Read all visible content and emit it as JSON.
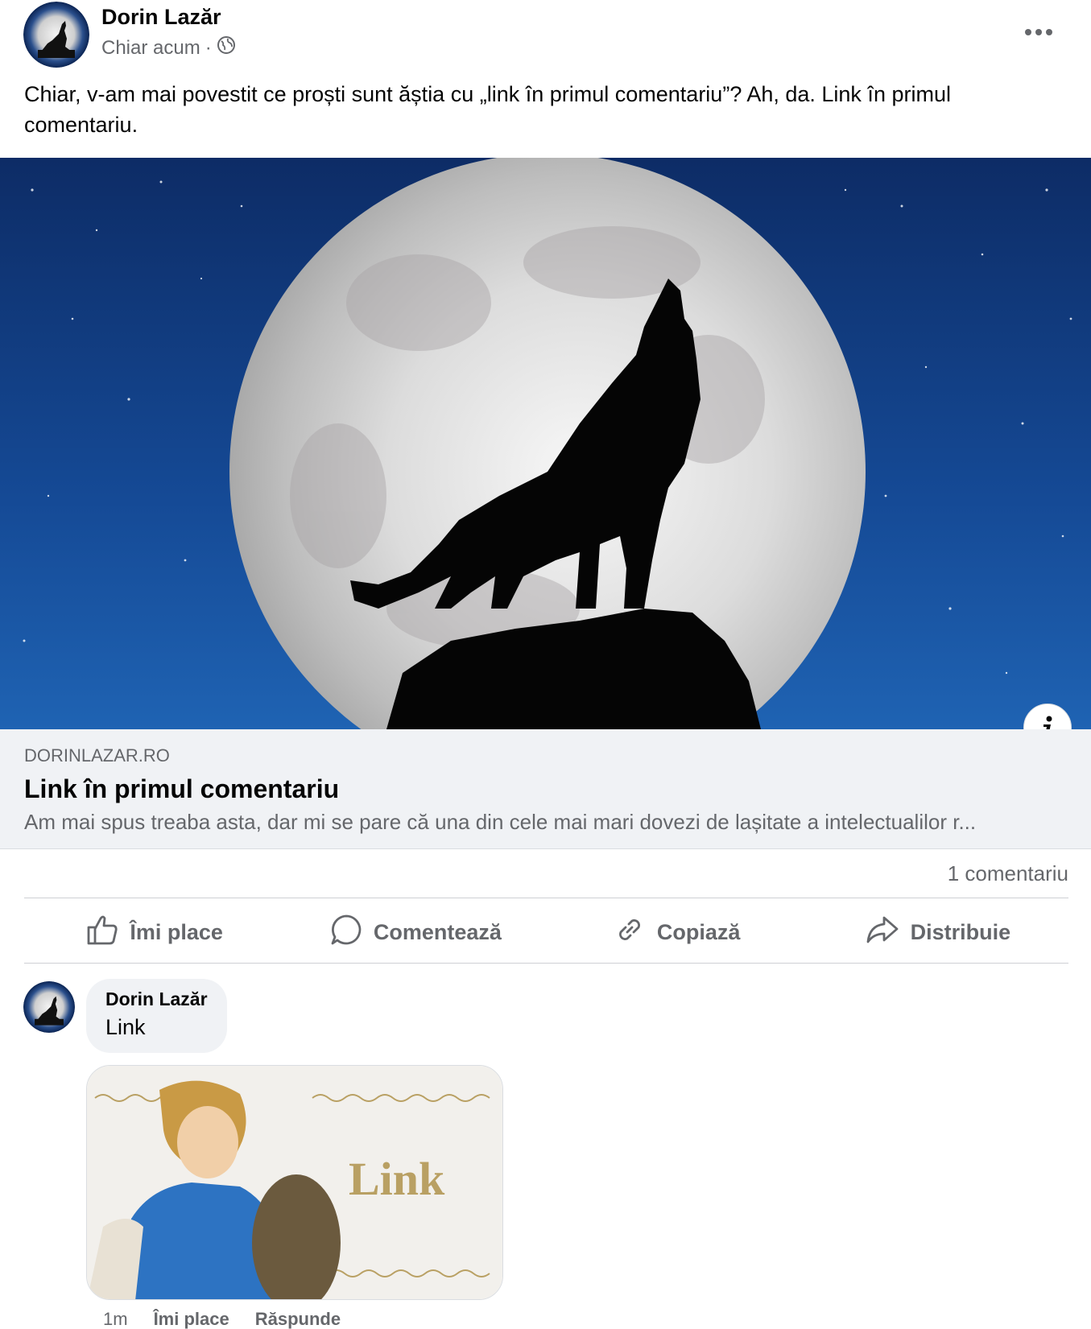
{
  "post": {
    "author": "Dorin Lazăr",
    "time": "Chiar acum",
    "separator": "·",
    "audience_icon": "globe-icon",
    "more_icon": "more-options-icon",
    "text": "Chiar, v-am mai povestit ce proști sunt ăștia cu „link în primul comentariu”? Ah, da. Link în primul comentariu."
  },
  "link_preview": {
    "domain": "DORINLAZAR.RO",
    "title": "Link în primul comentariu",
    "description": "Am mai spus treaba asta, dar mi se pare că una din cele mai mari dovezi de lașitate a intelectualilor r...",
    "info_icon": "info-icon"
  },
  "stats": {
    "comments": "1 comentariu"
  },
  "actions": {
    "like": "Îmi place",
    "comment": "Comentează",
    "copy": "Copiază",
    "share": "Distribuie"
  },
  "comment": {
    "author": "Dorin Lazăr",
    "text": "Link",
    "attachment_text": "Link",
    "time": "1m",
    "like": "Îmi place",
    "reply": "Răspunde"
  },
  "colors": {
    "secondary_text": "#65676b",
    "card_background": "#f0f2f5",
    "night_sky": "#123a78",
    "attachment_title": "#b9a063"
  }
}
